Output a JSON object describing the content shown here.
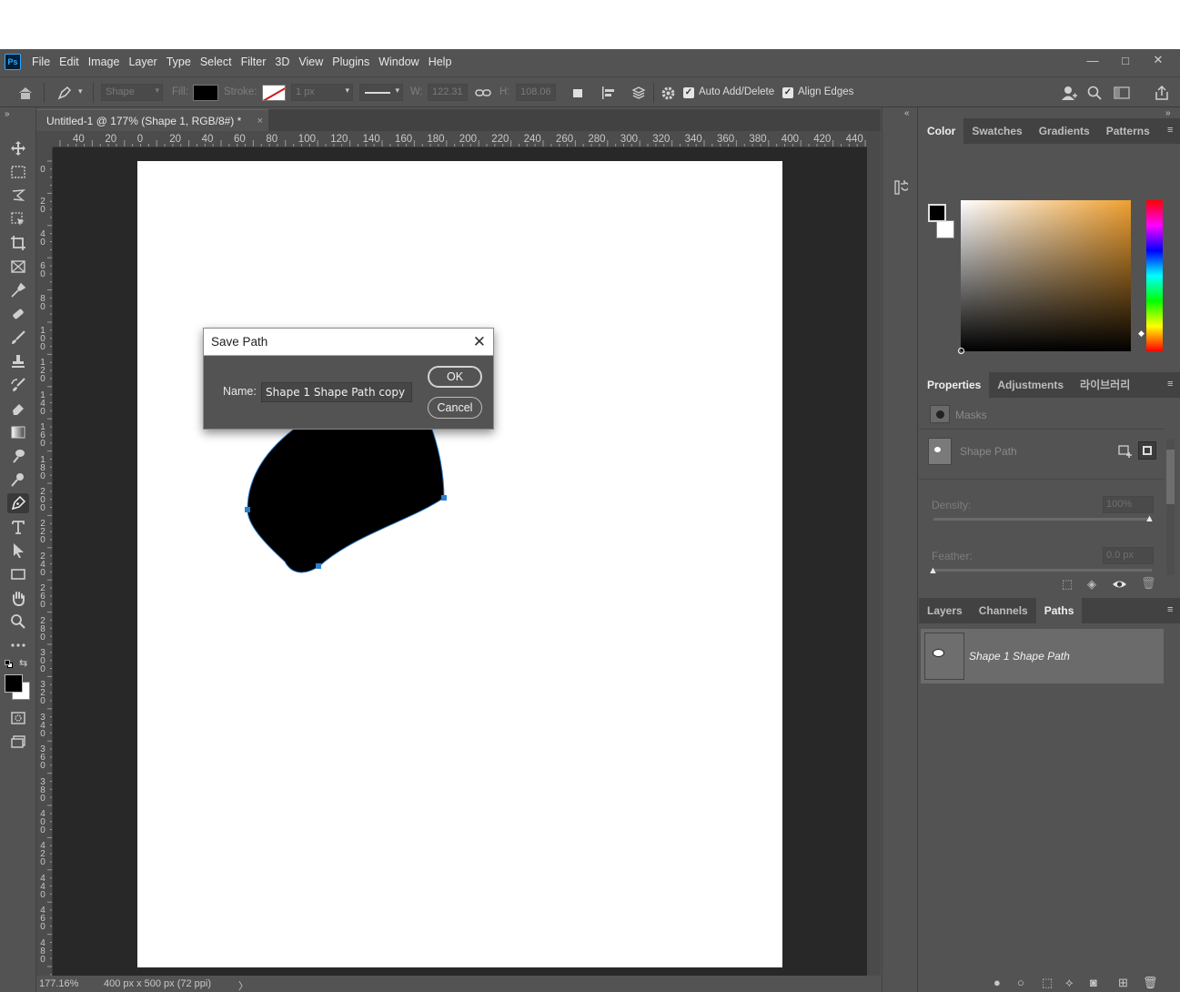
{
  "menu": [
    "File",
    "Edit",
    "Image",
    "Layer",
    "Type",
    "Select",
    "Filter",
    "3D",
    "View",
    "Plugins",
    "Window",
    "Help"
  ],
  "window_controls": {
    "minimize": "—",
    "maximize": "□",
    "close": "✕"
  },
  "options_bar": {
    "mode": "Shape",
    "fill_label": "Fill:",
    "stroke_label": "Stroke:",
    "stroke_width": "1 px",
    "w_label": "W:",
    "w_value": "122.31",
    "h_label": "H:",
    "h_value": "108.06",
    "auto_add_delete": "Auto Add/Delete",
    "align_edges": "Align Edges"
  },
  "document_tab": {
    "title": "Untitled-1 @ 177% (Shape 1, RGB/8#) *",
    "close": "×"
  },
  "ruler_h": [
    "40",
    "20",
    "0",
    "20",
    "40",
    "60",
    "80",
    "100",
    "120",
    "140",
    "160",
    "180",
    "200",
    "220",
    "240",
    "260",
    "280",
    "300",
    "320",
    "340",
    "360",
    "380",
    "400",
    "420",
    "440"
  ],
  "ruler_v": [
    "0",
    "20",
    "40",
    "60",
    "80",
    "100",
    "120",
    "140",
    "160",
    "180",
    "200",
    "220",
    "240",
    "260",
    "280",
    "300",
    "320",
    "340",
    "360",
    "380",
    "400",
    "420",
    "440",
    "460",
    "480"
  ],
  "status": {
    "zoom": "177.16%",
    "doc_info": "400 px x 500 px (72 ppi)",
    "arrow": "〉"
  },
  "color_panel": {
    "tabs": [
      "Color",
      "Swatches",
      "Gradients",
      "Patterns"
    ],
    "active_tab": "Color",
    "foreground": "#000000",
    "background": "#ffffff",
    "hue_color": "#f0a030"
  },
  "properties_panel": {
    "tabs": [
      "Properties",
      "Adjustments",
      "라이브러리"
    ],
    "active_tab": "Properties",
    "masks_label": "Masks",
    "shape_path_label": "Shape Path",
    "density_label": "Density:",
    "density_value": "100%",
    "feather_label": "Feather:",
    "feather_value": "0.0 px"
  },
  "paths_panel": {
    "tabs": [
      "Layers",
      "Channels",
      "Paths"
    ],
    "active_tab": "Paths",
    "items": [
      {
        "name": "Shape 1 Shape Path"
      }
    ]
  },
  "dialog": {
    "title": "Save Path",
    "close": "✕",
    "name_label": "Name:",
    "name_value": "Shape 1 Shape Path copy",
    "ok": "OK",
    "cancel": "Cancel"
  }
}
